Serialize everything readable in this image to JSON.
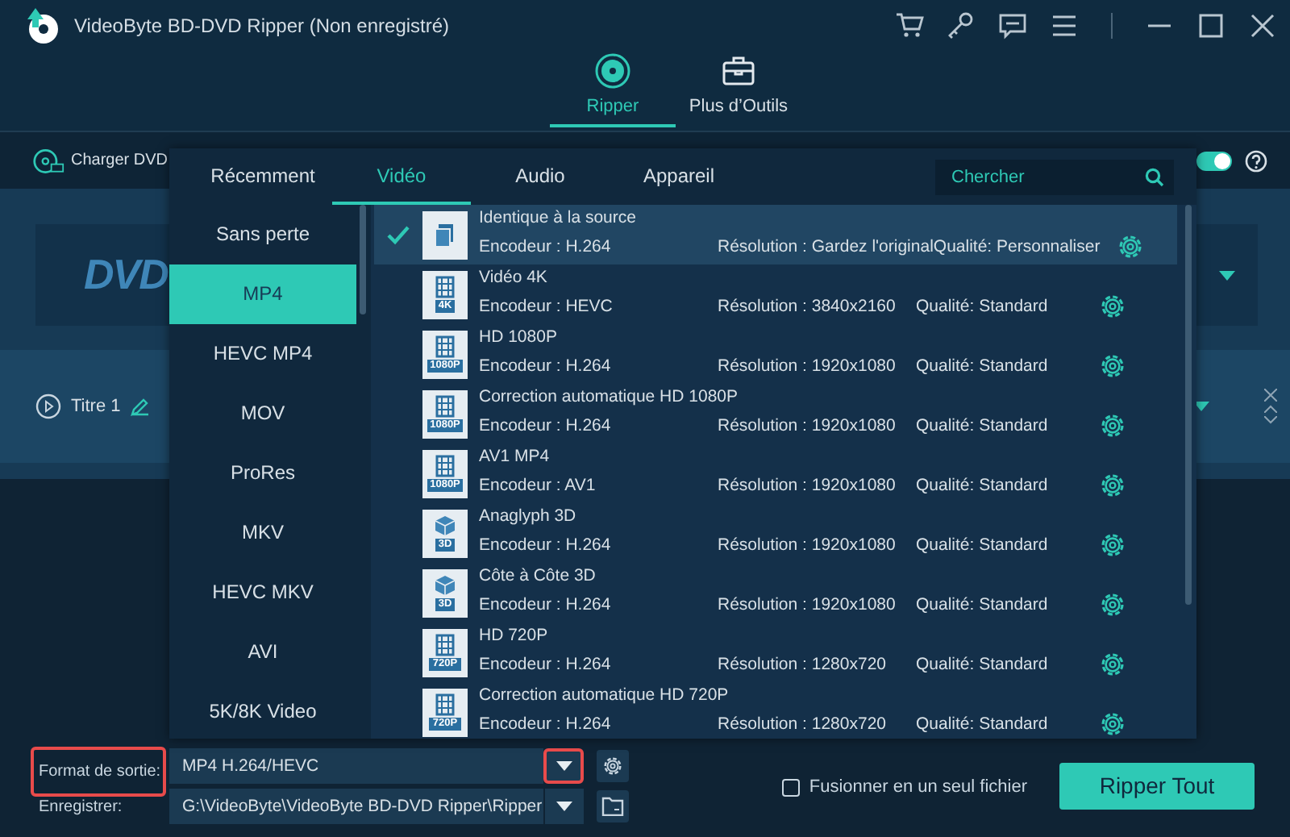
{
  "window": {
    "title": "VideoByte BD-DVD Ripper (Non enregistré)"
  },
  "nav_tabs": [
    {
      "label": "Ripper",
      "kind": "disc",
      "selected": true
    },
    {
      "label": "Plus d’Outils",
      "kind": "toolbox",
      "selected": false
    }
  ],
  "toolbar": {
    "load_button": "Charger DVD",
    "toggle_on": true
  },
  "source": {
    "logo": "DVD"
  },
  "titles": [
    {
      "label": "Titre 1"
    }
  ],
  "format_menu": {
    "tabs": [
      {
        "label": "Récemment",
        "selected": false
      },
      {
        "label": "Vidéo",
        "selected": true
      },
      {
        "label": "Audio",
        "selected": false
      },
      {
        "label": "Appareil",
        "selected": false
      }
    ],
    "search": {
      "placeholder": "Chercher"
    },
    "categories": [
      {
        "label": "Sans perte",
        "selected": false
      },
      {
        "label": "MP4",
        "selected": true
      },
      {
        "label": "HEVC MP4",
        "selected": false
      },
      {
        "label": "MOV",
        "selected": false
      },
      {
        "label": "ProRes",
        "selected": false
      },
      {
        "label": "MKV",
        "selected": false
      },
      {
        "label": "HEVC MKV",
        "selected": false
      },
      {
        "label": "AVI",
        "selected": false
      },
      {
        "label": "5K/8K Video",
        "selected": false
      }
    ],
    "profiles": [
      {
        "name": "Identique à la source",
        "kind": "copy",
        "encoder": "Encodeur : H.264",
        "resolution": "Résolution : Gardez l'original",
        "quality": "Qualité: Personnaliser",
        "selected": true
      },
      {
        "name": "Vidéo 4K",
        "kind": "film",
        "badge": "4K",
        "encoder": "Encodeur : HEVC",
        "resolution": "Résolution : 3840x2160",
        "quality": "Qualité: Standard",
        "selected": false
      },
      {
        "name": "HD 1080P",
        "kind": "film",
        "badge": "1080P",
        "encoder": "Encodeur : H.264",
        "resolution": "Résolution : 1920x1080",
        "quality": "Qualité: Standard",
        "selected": false
      },
      {
        "name": "Correction automatique HD 1080P",
        "kind": "film",
        "badge": "1080P",
        "encoder": "Encodeur : H.264",
        "resolution": "Résolution : 1920x1080",
        "quality": "Qualité: Standard",
        "selected": false
      },
      {
        "name": "AV1 MP4",
        "kind": "film",
        "badge": "1080P",
        "encoder": "Encodeur : AV1",
        "resolution": "Résolution : 1920x1080",
        "quality": "Qualité: Standard",
        "selected": false
      },
      {
        "name": "Anaglyph 3D",
        "kind": "cube",
        "badge": "3D",
        "encoder": "Encodeur : H.264",
        "resolution": "Résolution : 1920x1080",
        "quality": "Qualité: Standard",
        "selected": false
      },
      {
        "name": "Côte à Côte 3D",
        "kind": "cube",
        "badge": "3D",
        "encoder": "Encodeur : H.264",
        "resolution": "Résolution : 1920x1080",
        "quality": "Qualité: Standard",
        "selected": false
      },
      {
        "name": "HD 720P",
        "kind": "film",
        "badge": "720P",
        "encoder": "Encodeur : H.264",
        "resolution": "Résolution : 1280x720",
        "quality": "Qualité: Standard",
        "selected": false
      },
      {
        "name": "Correction automatique HD 720P",
        "kind": "film",
        "badge": "720P",
        "encoder": "Encodeur : H.264",
        "resolution": "Résolution : 1280x720",
        "quality": "Qualité: Standard",
        "selected": false
      }
    ]
  },
  "bottom_bar": {
    "output_format": {
      "label": "Format de sortie:",
      "value": "MP4 H.264/HEVC",
      "highlighted": true
    },
    "save_to": {
      "label": "Enregistrer:",
      "value": "G:\\VideoByte\\VideoByte BD-DVD Ripper\\Ripper"
    },
    "merge": {
      "label": "Fusionner en un seul fichier",
      "checked": false
    },
    "rip_button": "Ripper Tout"
  }
}
